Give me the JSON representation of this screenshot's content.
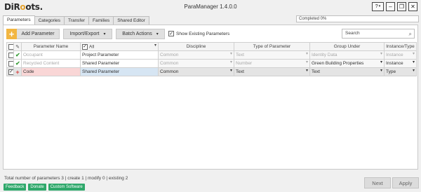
{
  "brand": {
    "logo_pre": "DiR",
    "logo_o": "o",
    "logo_post": "ots."
  },
  "window": {
    "title": "ParaManager 1.4.0.0",
    "help": "?",
    "help_caret": "▾",
    "minimize": "–",
    "restore": "❐",
    "close": "✕"
  },
  "tabs": [
    "Parameters",
    "Categories",
    "Transfer",
    "Families",
    "Shared Editor"
  ],
  "progress": {
    "text": "Completed 0%",
    "value": 0
  },
  "toolbar": {
    "add_label": "Add Parameter",
    "add_icon": "+",
    "import_export": "Import/Export",
    "batch_actions": "Batch Actions",
    "show_existing": "Show Existing Parameters",
    "show_existing_checked": true,
    "caret": "▾"
  },
  "search": {
    "placeholder": "Search",
    "icon": "⌕"
  },
  "grid": {
    "headers": {
      "name": "Parameter Name",
      "filter_all": "All",
      "discipline": "Discipline",
      "type": "Type of Parameter",
      "group": "Group Under",
      "instance": "Instance/Type",
      "edit_icon": "✎",
      "caret": "▾"
    },
    "rows": [
      {
        "checked": false,
        "state": "✔",
        "name": "Occupant",
        "param_type": "Project Parameter",
        "discipline": "Common",
        "type": "Text",
        "group": "Identity Data",
        "instance": "Instance"
      },
      {
        "checked": false,
        "state": "✔",
        "name": "Recycled Content",
        "param_type": "Shared Parameter",
        "discipline": "Common",
        "type": "Number",
        "group": "Green Building Properties",
        "instance": "Instance"
      },
      {
        "checked": true,
        "state": "+",
        "name": "Code",
        "param_type": "Shared Parameter",
        "discipline": "Common",
        "type": "Text",
        "group": "Text",
        "instance": "Type"
      }
    ]
  },
  "footer": {
    "status": "Total number of parameters 3 | create 1 | modify 0 | existing 2",
    "links": [
      "Feedback",
      "Donate",
      "Custom Software"
    ],
    "next": "Next",
    "apply": "Apply"
  },
  "colors": {
    "accent": "#f2b642",
    "link": "#2fa86b",
    "new_row": "#f9d6d6",
    "selected_cell": "#d6e5f3",
    "ok": "#3a9d3a",
    "new_mark": "#d64242"
  }
}
